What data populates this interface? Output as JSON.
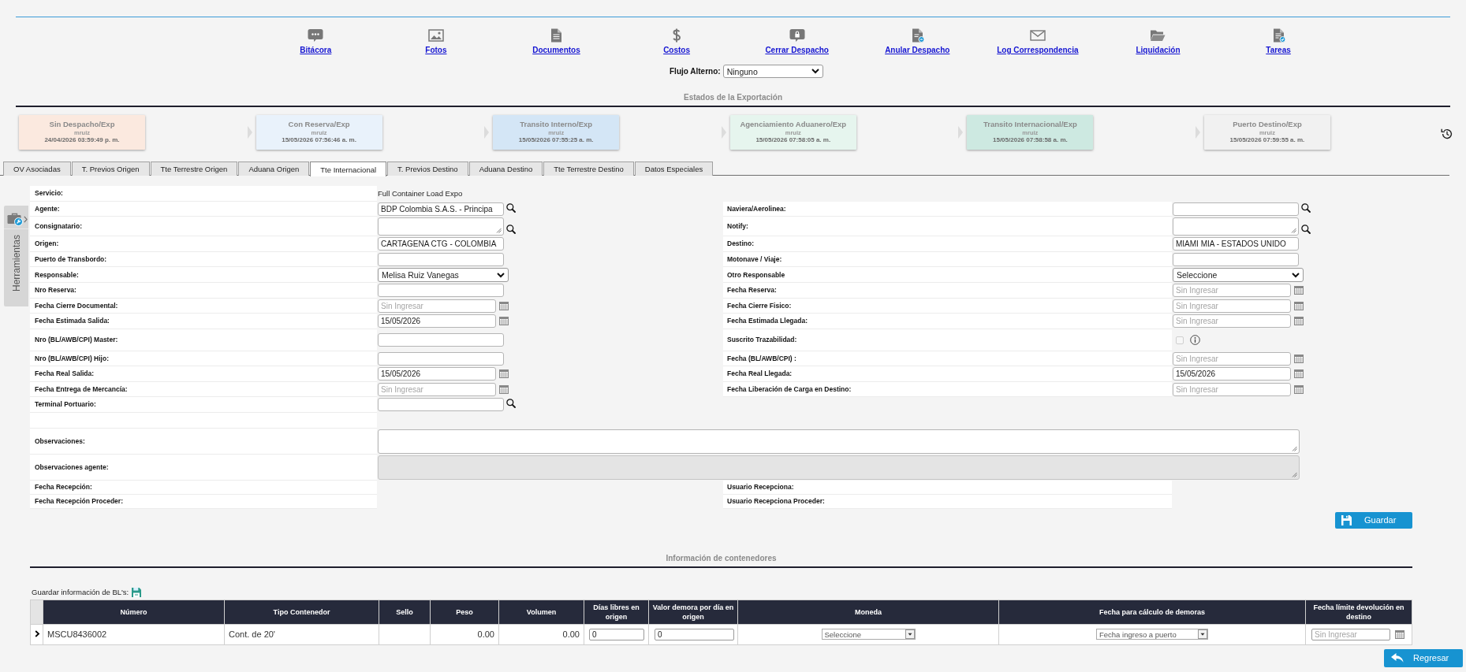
{
  "toolbar": {
    "items": [
      {
        "label": "Bitácora"
      },
      {
        "label": "Fotos"
      },
      {
        "label": "Documentos"
      },
      {
        "label": "Costos"
      },
      {
        "label": "Cerrar Despacho"
      },
      {
        "label": "Anular Despacho"
      },
      {
        "label": "Log Correspondencia"
      },
      {
        "label": "Liquidación"
      },
      {
        "label": "Tareas"
      }
    ]
  },
  "flow": {
    "label": "Flujo Alterno:",
    "value": "Ninguno"
  },
  "status": {
    "title": "Estados de la Exportación",
    "steps": [
      {
        "title": "Sin Despacho/Exp",
        "user": "mruiz",
        "date": "24/04/2026 03:59:49 p. m.",
        "color": "#fbe9df"
      },
      {
        "title": "Con Reserva/Exp",
        "user": "mruiz",
        "date": "15/05/2026 07:56:46 a. m.",
        "color": "#e9f2fb"
      },
      {
        "title": "Transito Interno/Exp",
        "user": "mruiz",
        "date": "15/05/2026 07:55:25 a. m.",
        "color": "#d4e6f6"
      },
      {
        "title": "Agenciamiento Aduanero/Exp",
        "user": "mruiz",
        "date": "15/05/2026 07:58:05 a. m.",
        "color": "#e6f5ee"
      },
      {
        "title": "Transito Internacional/Exp",
        "user": "mruiz",
        "date": "15/05/2026 07:58:58 a. m.",
        "color": "#cde9e1"
      },
      {
        "title": "Puerto Destino/Exp",
        "user": "mruiz",
        "date": "15/05/2026 07:59:55 a. m.",
        "color": "#f1f1f1"
      }
    ]
  },
  "tabs": [
    {
      "label": "OV Asociadas",
      "selected": false
    },
    {
      "label": "T. Previos Origen",
      "selected": false
    },
    {
      "label": "Tte Terrestre Origen",
      "selected": false
    },
    {
      "label": "Aduana Origen",
      "selected": false
    },
    {
      "label": "Tte Internacional",
      "selected": true
    },
    {
      "label": "T. Previos Destino",
      "selected": false
    },
    {
      "label": "Aduana Destino",
      "selected": false
    },
    {
      "label": "Tte Terrestre Destino",
      "selected": false
    },
    {
      "label": "Datos Especiales",
      "selected": false
    }
  ],
  "side_tab": {
    "label": "Herramientas"
  },
  "form": {
    "rows": [
      {
        "left": {
          "label": "Servicio:",
          "kind": "text",
          "value": "Full Container Load Expo"
        }
      },
      {
        "left": {
          "label": "Agente:",
          "kind": "lookup",
          "value": "BDP Colombia S.A.S. - Principa"
        },
        "right": {
          "label": "Naviera/Aerolinea:",
          "kind": "lookup"
        }
      },
      {
        "left": {
          "label": "Consignatario:",
          "kind": "lookup-area"
        },
        "right": {
          "label": "Notify:",
          "kind": "lookup-area"
        }
      },
      {
        "left": {
          "label": "Origen:",
          "kind": "input",
          "value": "CARTAGENA CTG - COLOMBIA"
        },
        "right": {
          "label": "Destino:",
          "kind": "input",
          "value": "MIAMI MIA - ESTADOS UNIDO"
        }
      },
      {
        "left": {
          "label": "Puerto de Transbordo:",
          "kind": "input"
        },
        "right": {
          "label": "Motonave / Viaje:",
          "kind": "input"
        }
      },
      {
        "left": {
          "label": "Responsable:",
          "kind": "select",
          "value": "Melisa Ruiz Vanegas"
        },
        "right": {
          "label": "Otro Responsable",
          "kind": "select",
          "value": "Seleccione"
        }
      },
      {
        "left": {
          "label": "Nro Reserva:",
          "kind": "input"
        },
        "right": {
          "label": "Fecha Reserva:",
          "kind": "date",
          "placeholder": "Sin Ingresar"
        }
      },
      {
        "left": {
          "label": "Fecha Cierre Documental:",
          "kind": "date",
          "placeholder": "Sin Ingresar"
        },
        "right": {
          "label": "Fecha Cierre Fisico:",
          "kind": "date",
          "placeholder": "Sin Ingresar"
        }
      },
      {
        "left": {
          "label": "Fecha Estimada Salida:",
          "kind": "date",
          "value": "15/05/2026"
        },
        "right": {
          "label": "Fecha Estimada Llegada:",
          "kind": "date",
          "placeholder": "Sin Ingresar"
        }
      },
      {
        "left": {
          "label": "Nro (BL/AWB/CPI) Master:",
          "kind": "input"
        },
        "right": {
          "label": "Suscrito Trazabilidad:",
          "kind": "checkbox",
          "checked": false,
          "disabled": true
        }
      },
      {
        "left": {
          "label": "Nro (BL/AWB/CPI) Hijo:",
          "kind": "input"
        },
        "right": {
          "label": "Fecha (BL/AWB/CPI) :",
          "kind": "date",
          "placeholder": "Sin Ingresar"
        }
      },
      {
        "left": {
          "label": "Fecha Real Salida:",
          "kind": "date",
          "value": "15/05/2026"
        },
        "right": {
          "label": "Fecha Real Llegada:",
          "kind": "date",
          "value": "15/05/2026"
        }
      },
      {
        "left": {
          "label": "Fecha Entrega de Mercancía:",
          "kind": "date",
          "placeholder": "Sin Ingresar"
        },
        "right": {
          "label": "Fecha Liberación de Carga en Destino:",
          "kind": "date",
          "placeholder": "Sin Ingresar"
        }
      },
      {
        "left": {
          "label": "Terminal Portuario:",
          "kind": "lookup"
        }
      }
    ],
    "notes": [
      {
        "label": "Observaciones:",
        "disabled": false
      },
      {
        "label": "Observaciones agente:",
        "disabled": true
      }
    ],
    "reception": [
      {
        "left": "Fecha Recepción:",
        "right": "Usuario Recepciona:"
      },
      {
        "left": "Fecha Recepción Proceder:",
        "right": "Usuario Recepciona Proceder:"
      }
    ],
    "save_button": "Guardar"
  },
  "containers": {
    "title": "Información de contenedores",
    "save_label": "Guardar información de BL's:",
    "columns": [
      "Número",
      "Tipo Contenedor",
      "Sello",
      "Peso",
      "Volumen",
      "Días libres en origen",
      "Valor demora por día en origen",
      "Moneda",
      "Fecha para cálculo de demoras",
      "Fecha límite devolución en destino"
    ],
    "rows": [
      {
        "expanded": false,
        "cells": [
          {
            "kind": "text",
            "value": "MSCU8436002"
          },
          {
            "kind": "text",
            "value": "Cont. de 20'"
          },
          {
            "kind": "text"
          },
          {
            "kind": "number",
            "value": "0.00"
          },
          {
            "kind": "number",
            "value": "0.00"
          },
          {
            "kind": "input",
            "value": "0"
          },
          {
            "kind": "input",
            "value": "0"
          },
          {
            "kind": "select",
            "value": "Seleccione"
          },
          {
            "kind": "select",
            "value": "Fecha ingreso a puerto"
          },
          {
            "kind": "date",
            "placeholder": "Sin Ingresar"
          }
        ]
      }
    ]
  },
  "back_button": "Regresar"
}
